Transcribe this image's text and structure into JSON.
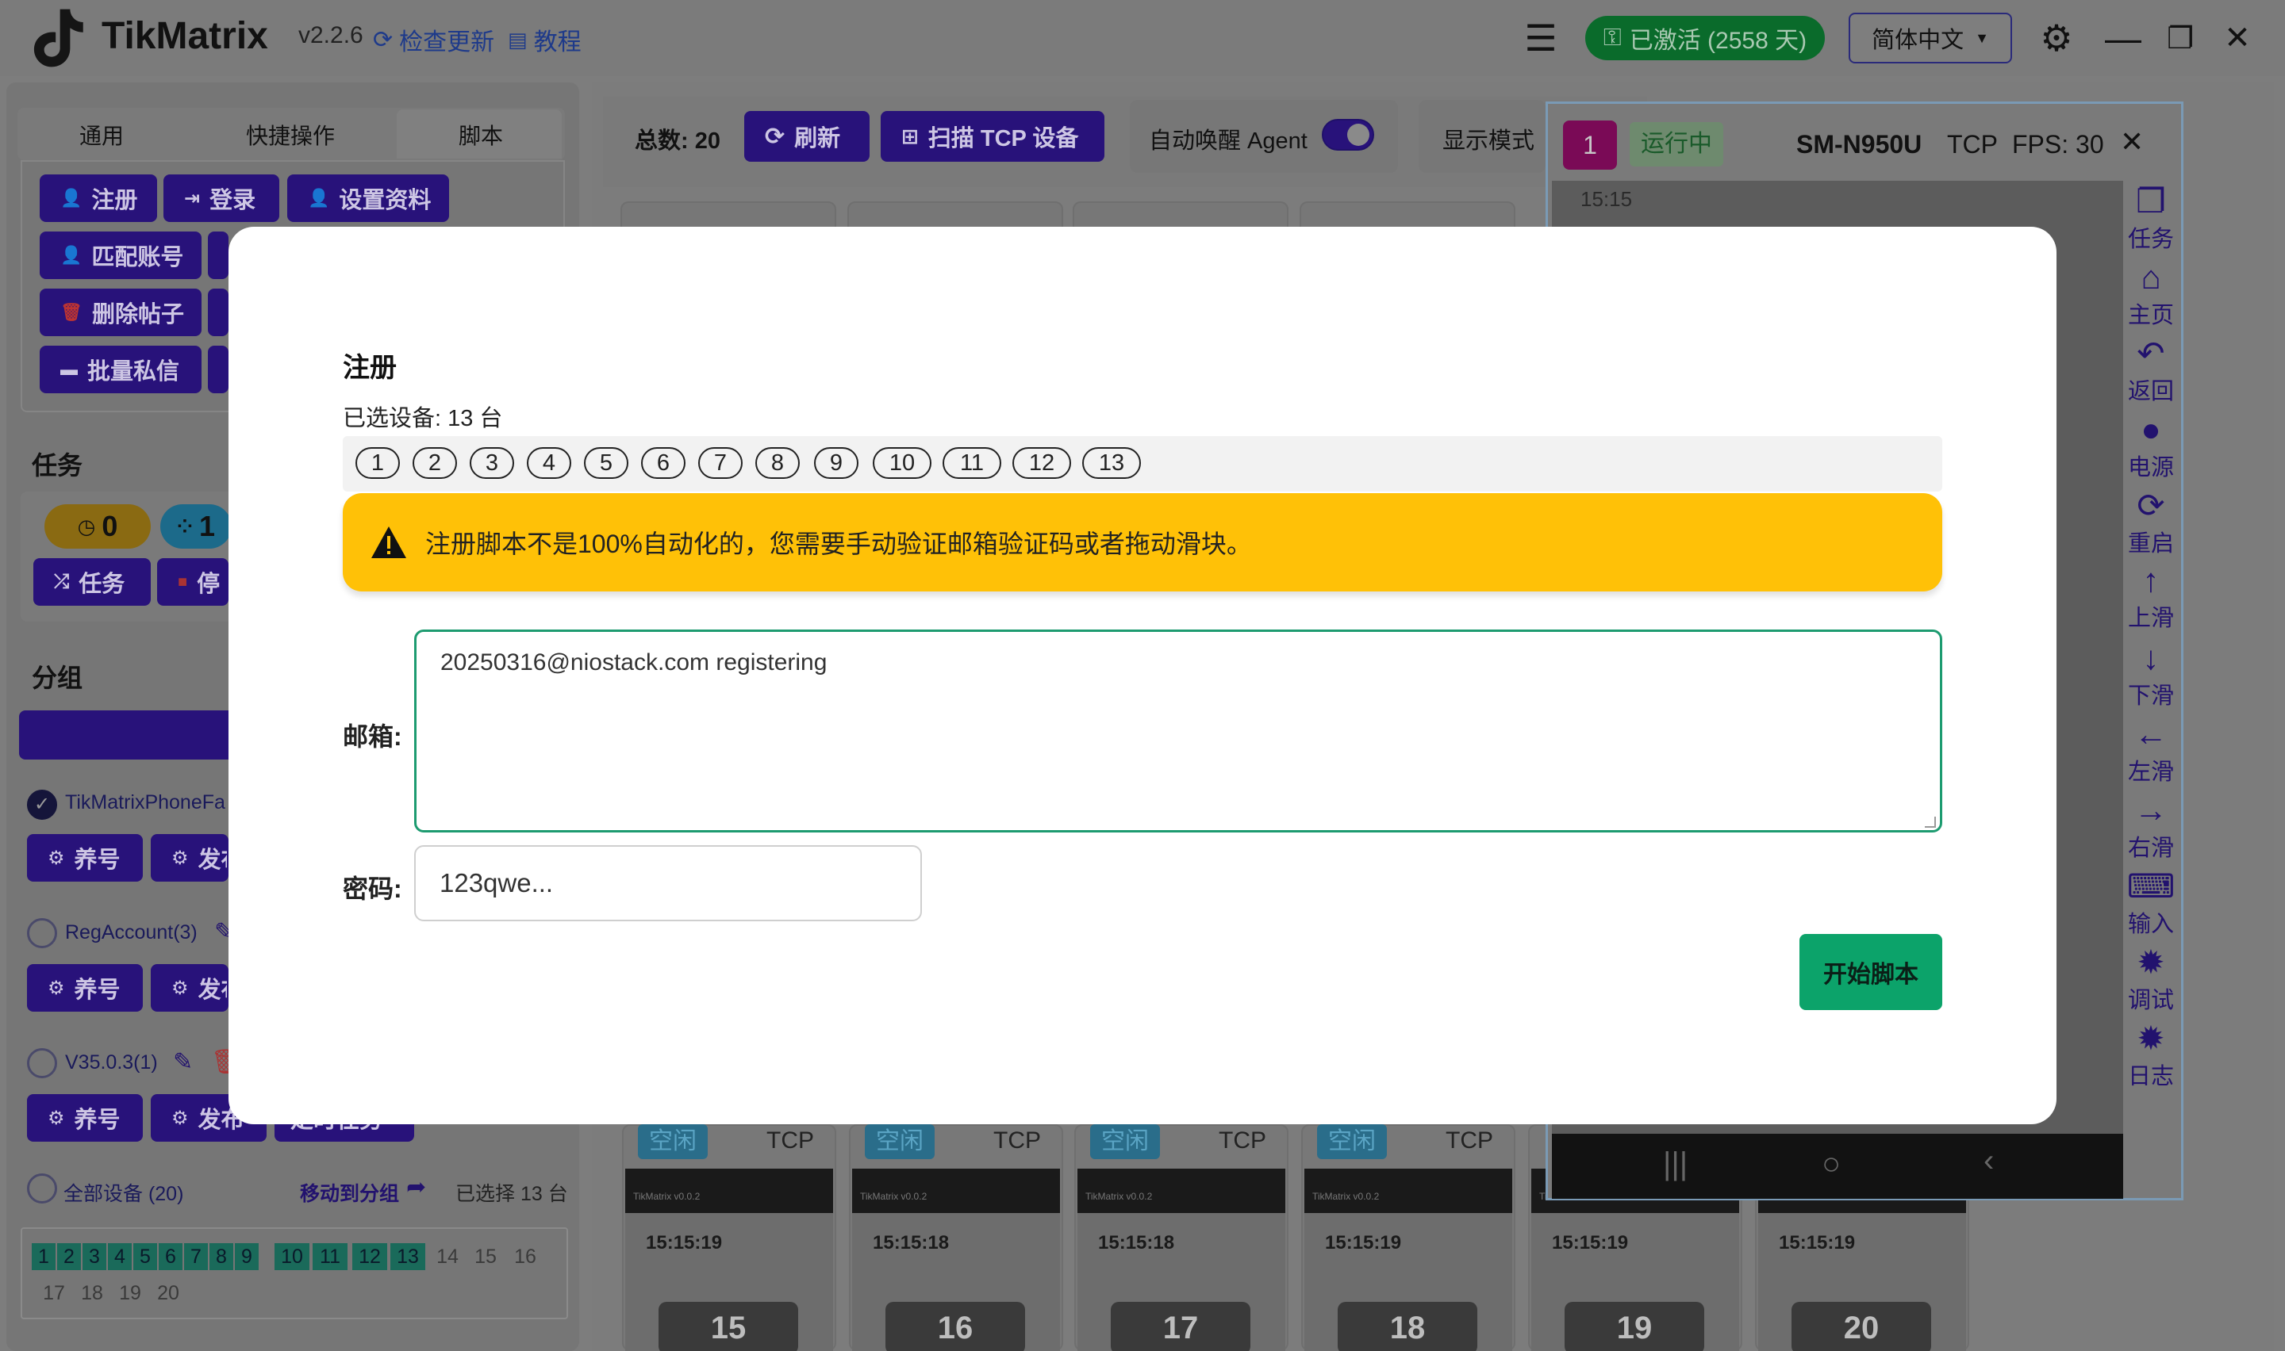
{
  "header": {
    "app_name": "TikMatrix",
    "version": "v2.2.6",
    "check_update": "检查更新",
    "tutorial": "教程",
    "activated": "已激活 (2558 天)",
    "language": "简体中文"
  },
  "left_panel": {
    "tabs": [
      "通用",
      "快捷操作",
      "脚本"
    ],
    "active_tab": "脚本",
    "script_buttons": {
      "register": "注册",
      "login": "登录",
      "set_profile": "设置资料",
      "match_account": "匹配账号",
      "delete_posts": "删除帖子",
      "batch_dm": "批量私信"
    },
    "tasks_heading": "任务",
    "task_count_a": "0",
    "task_count_b": "1",
    "task_button": "任务",
    "stop_button": "停",
    "groups_heading": "分组",
    "groups": [
      {
        "name": "TikMatrixPhoneFa",
        "checked": true
      },
      {
        "name": "RegAccount(3)",
        "checked": false
      },
      {
        "name": "V35.0.3(1)",
        "checked": false
      }
    ],
    "group_btn_nurture": "养号",
    "group_btn_post": "发布",
    "group_btn_schedule": "定时任务",
    "all_devices": "全部设备 (20)",
    "move_to_group": "移动到分组",
    "selected_count": "已选择 13 台",
    "device_numbers": [
      "1",
      "2",
      "3",
      "4",
      "5",
      "6",
      "7",
      "8",
      "9",
      "10",
      "11",
      "12",
      "13",
      "14",
      "15",
      "16",
      "17",
      "18",
      "19",
      "20"
    ],
    "selected_numbers": 13
  },
  "toolbar": {
    "total": "总数: 20",
    "refresh": "刷新",
    "scan_tcp": "扫描 TCP 设备",
    "auto_wake": "自动唤醒 Agent",
    "display_mode": "显示模式"
  },
  "device_cards": [
    {
      "num": "15",
      "status": "空闲",
      "conn": "TCP",
      "time": "15:15:19"
    },
    {
      "num": "16",
      "status": "空闲",
      "conn": "TCP",
      "time": "15:15:18"
    },
    {
      "num": "17",
      "status": "空闲",
      "conn": "TCP",
      "time": "15:15:18"
    },
    {
      "num": "18",
      "status": "空闲",
      "conn": "TCP",
      "time": "15:15:19"
    },
    {
      "num": "19",
      "status": "",
      "conn": "",
      "time": "15:15:19"
    },
    {
      "num": "20",
      "status": "",
      "conn": "",
      "time": "15:15:19"
    }
  ],
  "card_app_label": "TikMatrix v0.0.2",
  "phone_panel": {
    "index": "1",
    "status": "运行中",
    "model": "SM-N950U",
    "conn": "TCP",
    "fps": "FPS: 30",
    "clock": "15:15",
    "side_buttons": [
      "任务",
      "主页",
      "返回",
      "电源",
      "重启",
      "上滑",
      "下滑",
      "左滑",
      "右滑",
      "输入",
      "调试",
      "日志"
    ]
  },
  "modal": {
    "title": "注册",
    "selected_devices": "已选设备: 13 台",
    "chips": [
      "1",
      "2",
      "3",
      "4",
      "5",
      "6",
      "7",
      "8",
      "9",
      "10",
      "11",
      "12",
      "13"
    ],
    "warning": "注册脚本不是100%自动化的，您需要手动验证邮箱验证码或者拖动滑块。",
    "email_label": "邮箱:",
    "email_value": "20250316@niostack.com registering",
    "password_label": "密码:",
    "password_value": "123qwe...",
    "start_button": "开始脚本"
  },
  "colors": {
    "primary": "#28127a",
    "success": "#0ca36a",
    "warning": "#ffc107",
    "overlay": "#7d7d7d"
  }
}
